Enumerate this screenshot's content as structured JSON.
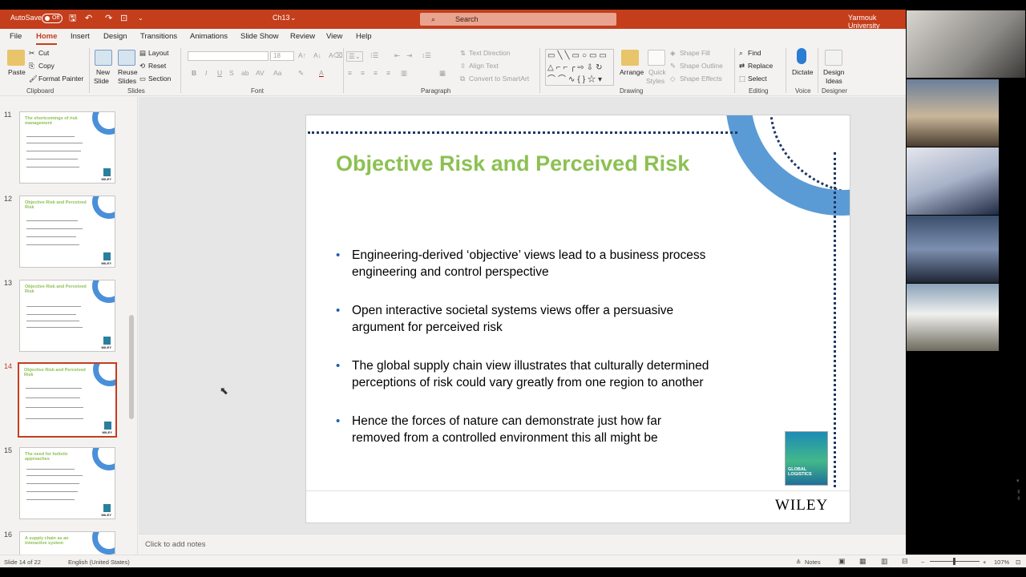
{
  "titlebar": {
    "autosave_label": "AutoSave",
    "autosave_state": "Off",
    "doc_title": "Ch13",
    "search_placeholder": "Search",
    "org": "Yarmouk University"
  },
  "menu": [
    "File",
    "Home",
    "Insert",
    "Design",
    "Transitions",
    "Animations",
    "Slide Show",
    "Review",
    "View",
    "Help"
  ],
  "menu_active": "Home",
  "ribbon": {
    "clipboard": {
      "paste": "Paste",
      "cut": "Cut",
      "copy": "Copy",
      "format_painter": "Format Painter",
      "label": "Clipboard"
    },
    "slides": {
      "new_slide_1": "New",
      "new_slide_2": "Slide",
      "reuse_1": "Reuse",
      "reuse_2": "Slides",
      "layout": "Layout",
      "reset": "Reset",
      "section": "Section",
      "label": "Slides"
    },
    "font": {
      "size": "18",
      "label": "Font"
    },
    "paragraph": {
      "text_direction": "Text Direction",
      "align_text": "Align Text",
      "smartart": "Convert to SmartArt",
      "label": "Paragraph"
    },
    "drawing": {
      "arrange": "Arrange",
      "quick_styles_1": "Quick",
      "quick_styles_2": "Styles",
      "shape_fill": "Shape Fill",
      "shape_outline": "Shape Outline",
      "shape_effects": "Shape Effects",
      "label": "Drawing"
    },
    "editing": {
      "find": "Find",
      "replace": "Replace",
      "select": "Select",
      "label": "Editing"
    },
    "voice": {
      "dictate": "Dictate",
      "label": "Voice"
    },
    "designer": {
      "ideas_1": "Design",
      "ideas_2": "Ideas",
      "label": "Designer"
    }
  },
  "thumbnails": [
    {
      "num": "11",
      "title": "The shortcomings of risk management"
    },
    {
      "num": "12",
      "title": "Objective Risk and Perceived Risk"
    },
    {
      "num": "13",
      "title": "Objective Risk and Perceived Risk"
    },
    {
      "num": "14",
      "title": "Objective Risk and Perceived Risk"
    },
    {
      "num": "15",
      "title": "The need for holistic approaches"
    },
    {
      "num": "16",
      "title": "A supply chain as an interactive system"
    }
  ],
  "active_slide": "14",
  "slide": {
    "title": "Objective Risk and Perceived Risk",
    "bullets": [
      "Engineering-derived ‘objective’ views lead to a business process engineering and control perspective",
      "Open interactive societal systems views offer a persuasive argument for perceived risk",
      "The global supply chain view illustrates that culturally determined perceptions of risk could vary greatly from one region to another",
      "Hence the forces of nature can demonstrate just how far removed from a controlled environment this all might be"
    ],
    "book_text": "GLOBAL LOGISTICS",
    "publisher": "WILEY"
  },
  "notes_placeholder": "Click to add notes",
  "status": {
    "slide_of": "Slide 14 of 22",
    "language": "English (United States)",
    "notes": "Notes",
    "zoom": "107%"
  },
  "colors": {
    "accent": "#c43e1c",
    "title_green": "#8cc152",
    "arc_blue": "#5b9bd5",
    "dot_navy": "#1f3864"
  }
}
